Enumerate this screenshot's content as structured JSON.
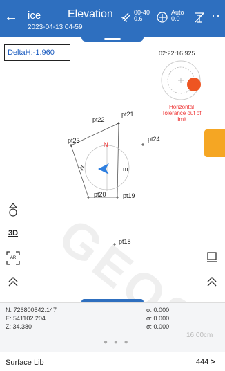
{
  "topbar": {
    "title": "ice",
    "date": "2023-04-13 04-59",
    "mode": "Elevation",
    "satellite": {
      "top": "00-40",
      "bottom": "0.6"
    },
    "solution": {
      "top": "Auto",
      "bottom": "0.0"
    },
    "more": "··"
  },
  "delta_h": "DeltaH:-1.960",
  "time": "02:22:16.925",
  "tolerance_text": "Horizontal Tolerance out of limit",
  "compass": {
    "n": "N",
    "m": "m",
    "w": "W"
  },
  "points": {
    "pt21": "pt21",
    "pt22": "pt22",
    "pt23": "pt23",
    "pt24": "pt24",
    "pt20": "pt20",
    "pt19": "pt19",
    "pt18": "pt18"
  },
  "toolbar": {
    "layers_3d": "3D",
    "ar": "AR"
  },
  "coords": {
    "n": "N: 726800542.147",
    "e": "E: 541102.204",
    "z": "Z: 34.380",
    "sig1": "σ: 0.000",
    "sig2": "σ: 0.000",
    "sig3": "σ: 0.000"
  },
  "scale": "16.00cm",
  "page_dots": "● ● ●",
  "watermark": "GEOS",
  "bottom": {
    "label": "Surface Lib",
    "count": "444",
    "chevron": ">"
  },
  "colors": {
    "topbar": "#2e6fbf",
    "accent": "#f5a623",
    "alert": "#e33"
  }
}
